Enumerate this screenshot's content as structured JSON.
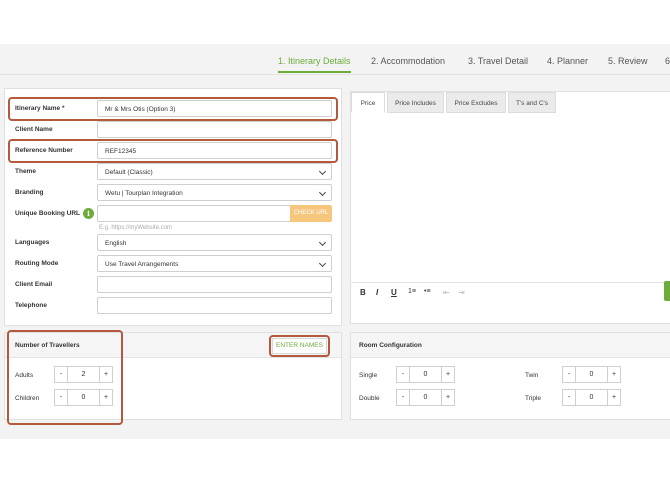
{
  "steps": [
    {
      "label": "1. Itinerary Details",
      "active": true
    },
    {
      "label": "2. Accommodation"
    },
    {
      "label": "3. Travel Detail"
    },
    {
      "label": "4. Planner"
    },
    {
      "label": "5. Review"
    },
    {
      "label": "6"
    }
  ],
  "form": {
    "itinerary_name": {
      "label": "Itinerary Name *",
      "value": "Mr & Mrs Otis (Option 3)"
    },
    "client_name": {
      "label": "Client Name",
      "value": ""
    },
    "reference_number": {
      "label": "Reference Number",
      "value": "REF12345"
    },
    "theme": {
      "label": "Theme",
      "value": "Default (Classic)"
    },
    "branding": {
      "label": "Branding",
      "value": "Wetu | Tourplan Integration"
    },
    "booking_url": {
      "label": "Unique Booking URL",
      "info_icon": "i",
      "button": "CHECK URL",
      "hint": "E.g. https://myWebsite.com"
    },
    "languages": {
      "label": "Languages",
      "value": "English"
    },
    "routing_mode": {
      "label": "Routing Mode",
      "value": "Use Travel Arrangements"
    },
    "client_email": {
      "label": "Client Email",
      "value": ""
    },
    "telephone": {
      "label": "Telephone",
      "value": ""
    }
  },
  "price_tabs": [
    "Price",
    "Price Includes",
    "Price Excludes",
    "T's and C's"
  ],
  "editor_toolbar": {
    "bold": "B",
    "italic": "I",
    "underline": "U",
    "ordered_list": "1≡",
    "bullet_list": "•≡",
    "outdent": "⇤",
    "indent": "⇥"
  },
  "travellers": {
    "title": "Number of Travellers",
    "enter_names": "ENTER NAMES",
    "adults": {
      "label": "Adults",
      "value": "2"
    },
    "children": {
      "label": "Children",
      "value": "0"
    }
  },
  "room_config": {
    "title": "Room Configuration",
    "single": {
      "label": "Single",
      "value": "0"
    },
    "double": {
      "label": "Double",
      "value": "0"
    },
    "twin": {
      "label": "Twin",
      "value": "0"
    },
    "triple": {
      "label": "Triple",
      "value": "0"
    }
  },
  "stepper": {
    "minus": "-",
    "plus": "+"
  },
  "colors": {
    "accent": "#6cab3c",
    "callout": "#b35a3c",
    "check_url_button": "#f7c67d"
  }
}
